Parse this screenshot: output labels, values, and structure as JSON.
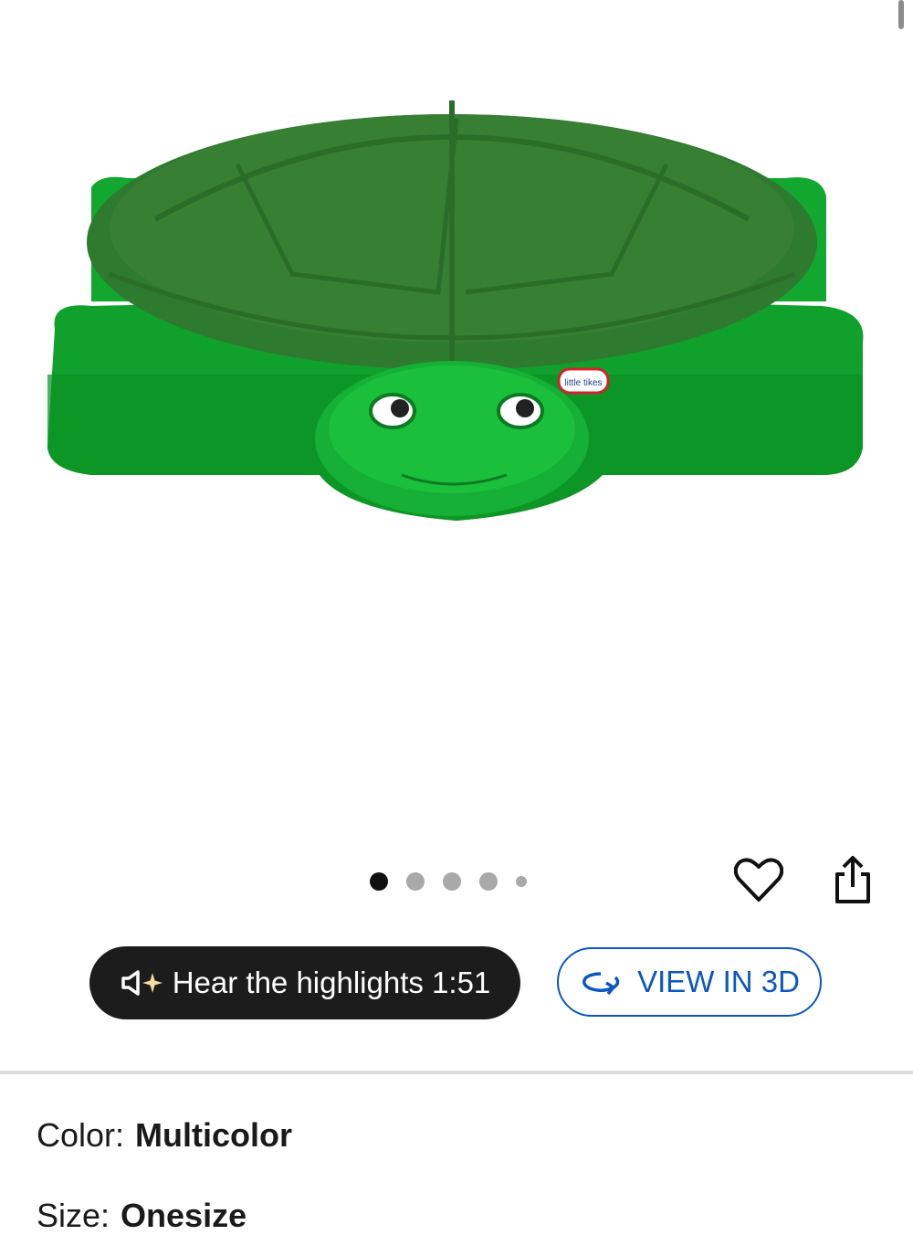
{
  "gallery": {
    "image_alt": "Little Tikes green turtle sandbox",
    "brand_logo_text": "little tikes",
    "dots_count": 5,
    "active_dot": 0
  },
  "actions": {
    "favorite_icon": "heart-outline-icon",
    "share_icon": "share-icon"
  },
  "audio": {
    "label": "Hear the highlights 1:51",
    "icon": "speaker-sparkle-icon"
  },
  "view3d": {
    "label": "VIEW IN 3D",
    "icon": "rotate-3d-icon"
  },
  "attributes": {
    "color_label": "Color:",
    "color_value": "Multicolor",
    "size_label": "Size:",
    "size_value": "Onesize"
  },
  "colors": {
    "shell_dark": "#2e7a2e",
    "body_green": "#0fa12b",
    "accent_blue": "#0a57c2",
    "pill_bg": "#1c1c1c"
  }
}
